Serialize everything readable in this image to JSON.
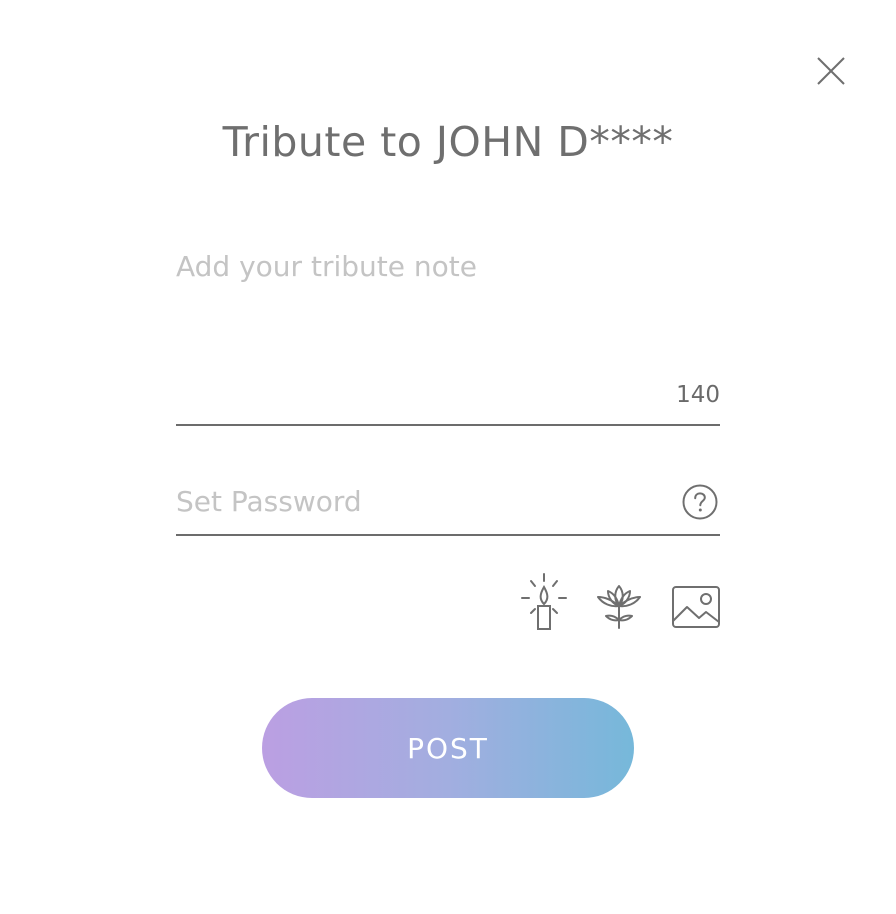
{
  "modal": {
    "title": "Tribute to JOHN D****",
    "close_icon": "close-icon"
  },
  "note": {
    "placeholder": "Add your tribute note",
    "value": "",
    "char_count": "140"
  },
  "password": {
    "placeholder": "Set Password",
    "value": "",
    "help_icon": "question-circle-icon"
  },
  "tools": [
    {
      "icon": "candle-icon"
    },
    {
      "icon": "lotus-flower-icon"
    },
    {
      "icon": "image-icon"
    }
  ],
  "post_button": {
    "label": "POST"
  },
  "colors": {
    "gradient_start": "#bb9fe2",
    "gradient_end": "#76b8da",
    "text": "#6f6f6f",
    "placeholder": "#c4c4c4",
    "underline": "#6c6c6c"
  }
}
